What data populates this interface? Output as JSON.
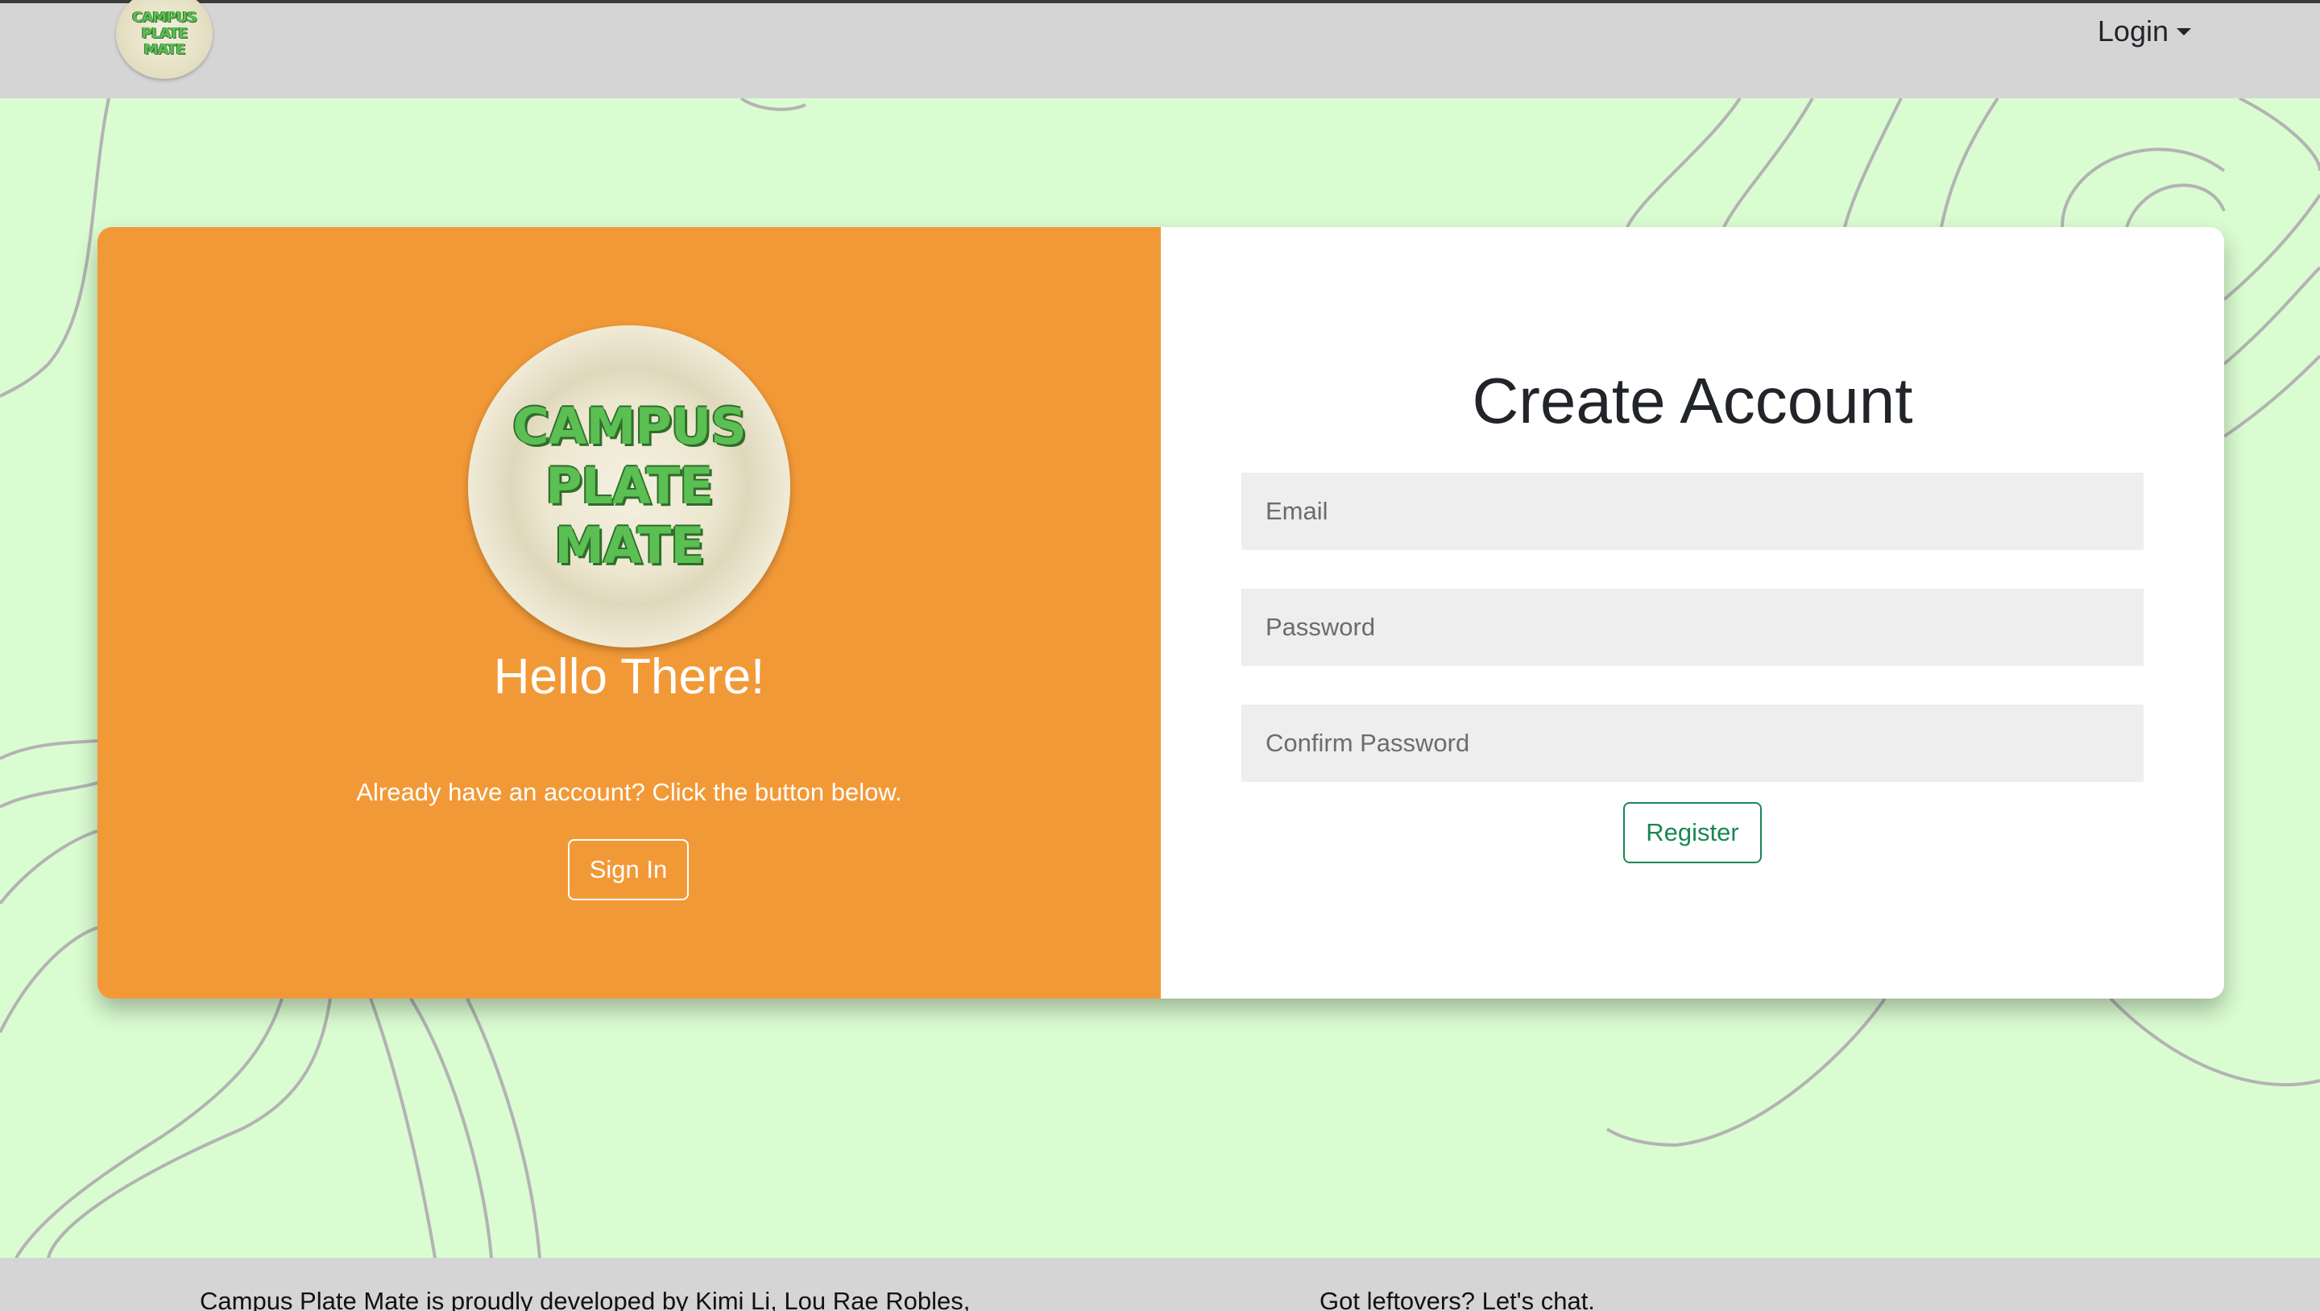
{
  "navbar": {
    "logo_lines": [
      "CAMPUS",
      "PLATE",
      "MATE"
    ],
    "login_label": "Login"
  },
  "left_panel": {
    "logo_lines": [
      "CAMPUS",
      "PLATE",
      "MATE"
    ],
    "greeting": "Hello There!",
    "prompt": "Already have an account? Click the button below.",
    "signin_label": "Sign In",
    "background_color": "#f29937"
  },
  "right_panel": {
    "title": "Create Account",
    "email_placeholder": "Email",
    "password_placeholder": "Password",
    "confirm_placeholder": "Confirm Password",
    "register_label": "Register",
    "accent_color": "#198754"
  },
  "footer": {
    "left_text": "Campus Plate Mate is proudly developed by Kimi Li, Lou Rae Robles,",
    "right_text": "Got leftovers? Let's chat."
  },
  "colors": {
    "page_background": "#dafcd1",
    "navbar_background": "#d5d5d5"
  }
}
